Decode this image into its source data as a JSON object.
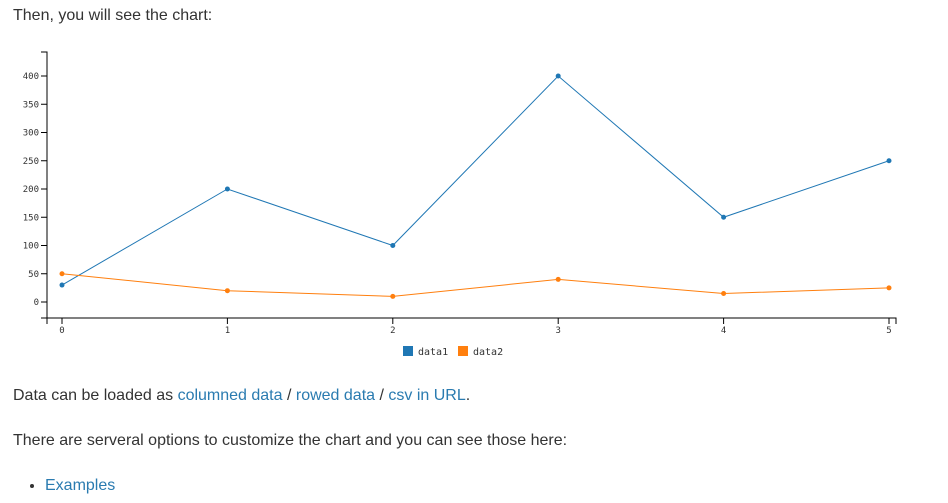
{
  "intro": {
    "text": "Then, you will see the chart:"
  },
  "chart_data": {
    "type": "line",
    "x": [
      0,
      1,
      2,
      3,
      4,
      5
    ],
    "series": [
      {
        "name": "data1",
        "values": [
          30,
          200,
          100,
          400,
          150,
          250
        ],
        "color": "#1f77b4"
      },
      {
        "name": "data2",
        "values": [
          50,
          20,
          10,
          40,
          15,
          25
        ],
        "color": "#ff7f0e"
      }
    ],
    "yticks": [
      0,
      50,
      100,
      150,
      200,
      250,
      300,
      350,
      400
    ],
    "xticks": [
      0,
      1,
      2,
      3,
      4,
      5
    ],
    "ylim": [
      -30,
      435
    ],
    "xlim": [
      0,
      5
    ],
    "legend": "bottom-center",
    "grid": false
  },
  "data_para": {
    "prefix": "Data can be loaded as ",
    "links": [
      "columned data",
      "rowed data",
      "csv in URL"
    ],
    "separator": " / ",
    "suffix": "."
  },
  "options_para": {
    "text": "There are serveral options to customize the chart and you can see those here:"
  },
  "list": {
    "items": [
      "Examples"
    ]
  }
}
